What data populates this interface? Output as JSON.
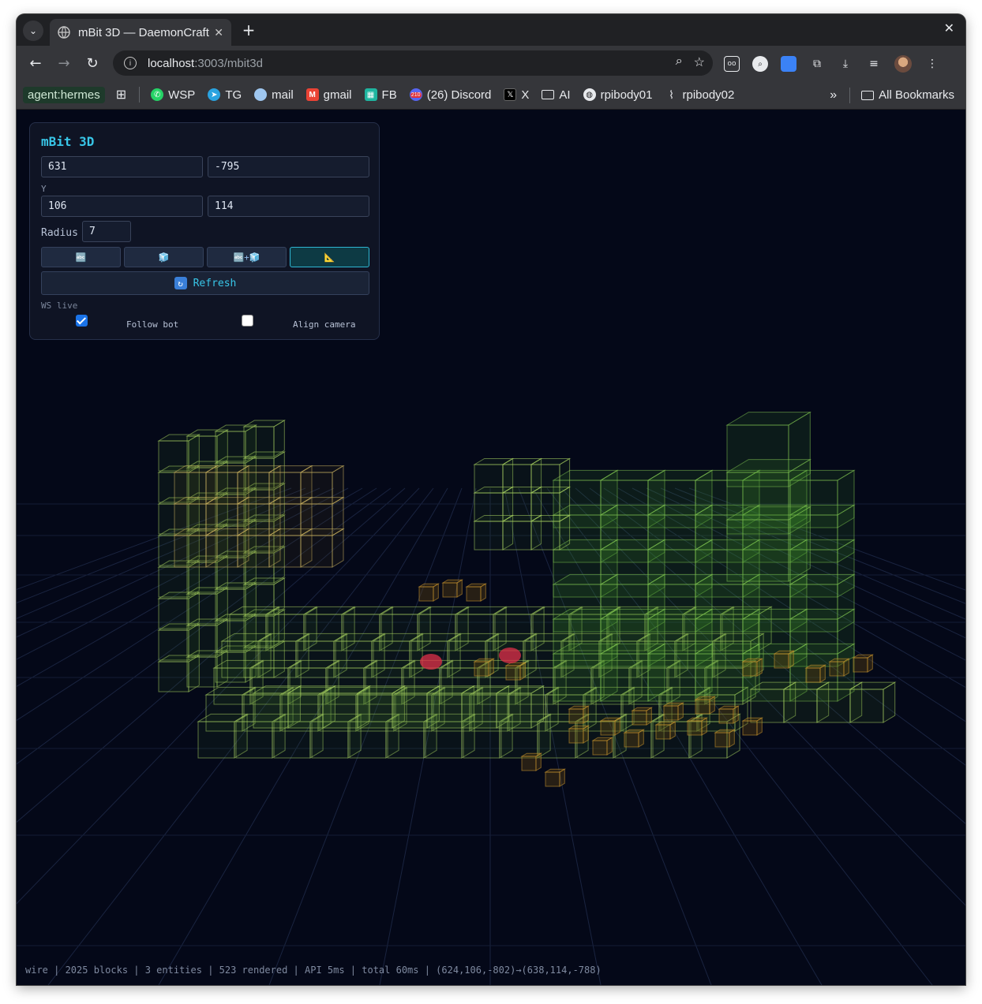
{
  "browser": {
    "tab_title": "mBit 3D — DaemonCraft",
    "url_host": "localhost",
    "url_path": ":3003/mbit3d",
    "bookmarks": [
      {
        "label": "agent:hermes",
        "icon": "tag-icon"
      },
      {
        "label": "WSP",
        "icon": "whatsapp-icon"
      },
      {
        "label": "TG",
        "icon": "telegram-icon"
      },
      {
        "label": "mail",
        "icon": "mail-icon"
      },
      {
        "label": "gmail",
        "icon": "gmail-icon"
      },
      {
        "label": "FB",
        "icon": "fb-icon"
      },
      {
        "label": "(26) Discord",
        "icon": "discord-icon"
      },
      {
        "label": "X",
        "icon": "x-icon"
      },
      {
        "label": "AI",
        "icon": "folder-icon"
      },
      {
        "label": "rpibody01",
        "icon": "globe-icon"
      },
      {
        "label": "rpibody02",
        "icon": "paperclip-icon"
      }
    ],
    "discord_badge": "210",
    "all_bookmarks": "All Bookmarks"
  },
  "panel": {
    "title": "mBit 3D",
    "x_min": "631",
    "z_min": "-795",
    "y_label": "Y",
    "y_min": "106",
    "y_max": "114",
    "radius_label": "Radius",
    "radius": "7",
    "modes": [
      "🔤",
      "🧊",
      "🔤+🧊",
      "📐"
    ],
    "active_mode": 3,
    "refresh_label": "Refresh",
    "ws_status": "WS live",
    "follow_bot_label": "Follow bot",
    "follow_bot": true,
    "align_camera_label": "Align camera",
    "align_camera": false
  },
  "status_bar": "wire | 2025 blocks | 3 entities | 523 rendered | API 5ms | total 60ms | (624,106,-802)→(638,114,-788)",
  "colors": {
    "viewport_bg": "#040818",
    "accent": "#38c6e8",
    "block_edge": "#a8d060",
    "block_fill": "#3c6a24",
    "ore_edge": "#d29a30",
    "entity": "#e0304a"
  }
}
